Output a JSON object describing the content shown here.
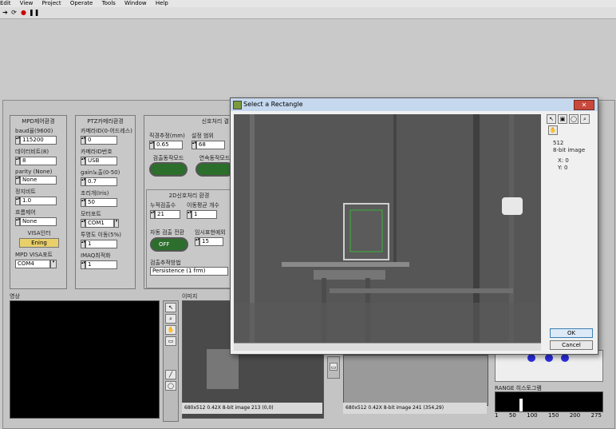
{
  "menubar": {
    "items": [
      "Edit",
      "View",
      "Project",
      "Operate",
      "Tools",
      "Window",
      "Help"
    ]
  },
  "panels": {
    "mpd": {
      "title": "MPD제어환경",
      "fields": [
        {
          "label": "baud율(9600)",
          "value": "115200"
        },
        {
          "label": "데이터비트(8)",
          "value": "8"
        },
        {
          "label": "parity (None)",
          "value": "None"
        },
        {
          "label": "정지비트",
          "value": "1.0"
        },
        {
          "label": "흐름제어",
          "value": "None"
        }
      ],
      "button_label_top": "VISA인터",
      "button_label": "Ening",
      "visa_label": "MPD VISA포트",
      "visa_value": "COM4"
    },
    "ptz": {
      "title": "PTZ카메라환경",
      "fields": [
        {
          "label": "카메라ID(0-어드레스)",
          "value": "0"
        },
        {
          "label": "카메라ID번호",
          "value": "USB"
        },
        {
          "label": "gain노출(0-50)",
          "value": "0.7"
        },
        {
          "label": "조리개(Iris)",
          "value": "50"
        },
        {
          "label": "모터포트",
          "value": "COM1"
        },
        {
          "label": "투명도 이동(5%)",
          "value": "1"
        },
        {
          "label": "IMAQ최적화",
          "value": "1"
        }
      ]
    },
    "sin": {
      "title": "신호처리 결",
      "row1": [
        {
          "label": "직경추정(mm)",
          "value": "0.65"
        },
        {
          "label": "설정 범위",
          "value": "68"
        }
      ],
      "toggle_labels": [
        "검출동작모드",
        "연속동작모드"
      ],
      "sub_title": "2D신호처리 환경",
      "row2": [
        {
          "label": "누적검출수",
          "value": "21"
        },
        {
          "label": "이동평균 개수",
          "value": "1"
        }
      ],
      "row3_labels": [
        "자동 검출 전환",
        "임시표현예외"
      ],
      "off_label": "OFF",
      "row3_value": "15",
      "tracking_label": "검출추적방법",
      "tracking_value": "Persistence (1 frm)"
    },
    "video_label": "영상",
    "img1_label": "이미지",
    "img1_status": "680x512 0.42X 8-bit image 213     (0,0)",
    "img2_status": "680x512 0.42X 8-bit image 241     (354,29)",
    "range_label": "RANGE 히스토그램",
    "range_ticks": [
      "1",
      "50",
      "100",
      "150",
      "200",
      "275"
    ]
  },
  "dialog": {
    "title": "Select a Rectangle",
    "info_line1": "512",
    "info_line2": "8-bit image",
    "x_label": "X:",
    "x_value": "0",
    "y_label": "Y:",
    "y_value": "0",
    "ok_label": "OK",
    "cancel_label": "Cancel"
  }
}
